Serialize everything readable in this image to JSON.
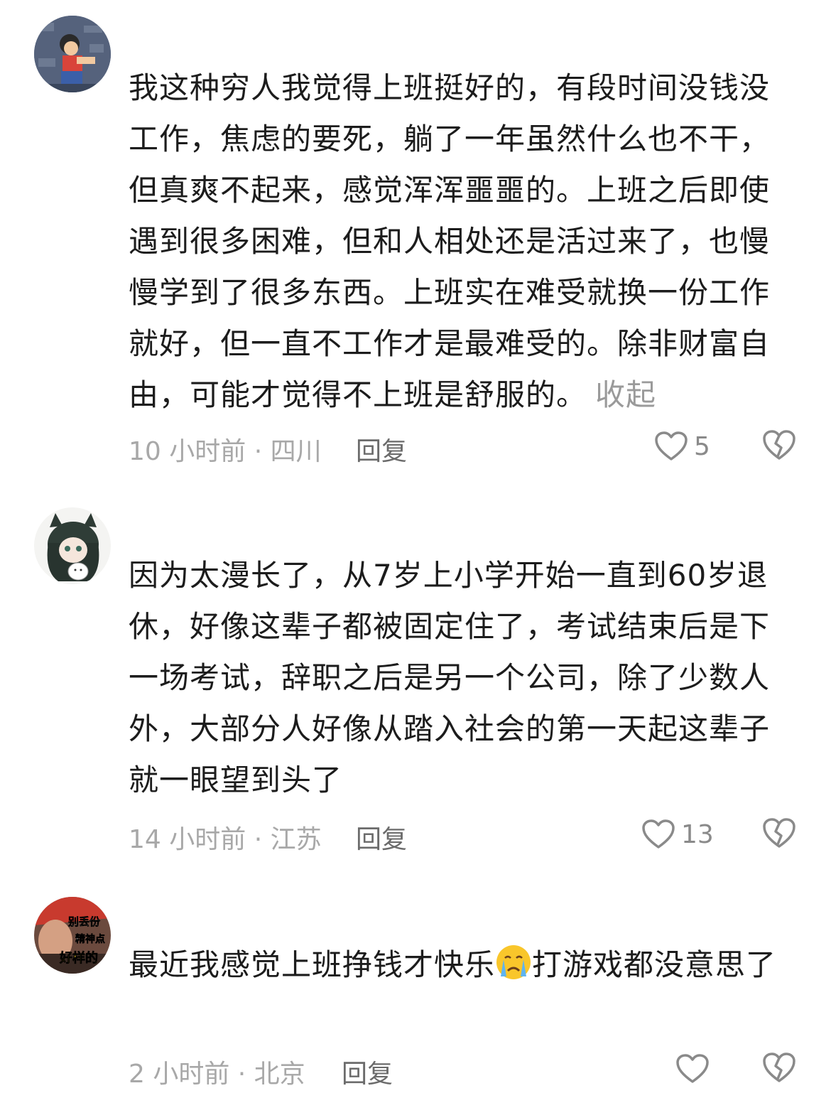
{
  "comments": [
    {
      "text": "我这种穷人我觉得上班挺好的，有段时间没钱没工作，焦虑的要死，躺了一年虽然什么也不干，但真爽不起来，感觉浑浑噩噩的。上班之后即使遇到很多困难，但和人相处还是活过来了，也慢慢学到了很多东西。上班实在难受就换一份工作就好，但一直不工作才是最难受的。除非财富自由，可能才觉得不上班是舒服的。",
      "collapse_label": "收起",
      "time_location": "10 小时前 · 四川",
      "reply_label": "回复",
      "like_count": "5"
    },
    {
      "text": "因为太漫长了，从7岁上小学开始一直到60岁退休，好像这辈子都被固定住了，考试结束后是下一场考试，辞职之后是另一个公司，除了少数人外，大部分人好像从踏入社会的第一天起这辈子就一眼望到头了",
      "time_location": "14 小时前 · 江苏",
      "reply_label": "回复",
      "like_count": "13"
    },
    {
      "text_before_emoji": "最近我感觉上班挣钱才快乐",
      "text_after_emoji": "打游戏都没意思了",
      "emoji_icon": "crying-face",
      "avatar_caption": [
        "别丢份",
        "精神点",
        "好样的"
      ],
      "time_location": "2 小时前 · 北京",
      "reply_label": "回复",
      "like_count": ""
    }
  ],
  "colors": {
    "text": "#1c1c1c",
    "meta": "#a8a8a8",
    "reply": "#6b6b6b",
    "icon": "#8a8a8a"
  }
}
